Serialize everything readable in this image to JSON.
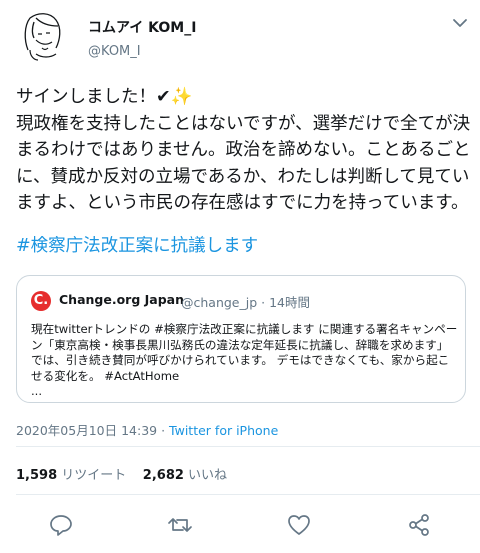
{
  "user": {
    "display_name": "コムアイ KOM_I",
    "handle": "@KOM_I"
  },
  "tweet": {
    "lines": [
      "サインしました！✔✨",
      "現政権を支持したことはないですが、選挙だけで全てが決",
      "まるわけではありません。政治を諦めない。ことあるごと",
      "に、賛成か反対の立場であるか、わたしは判断して見てい",
      "ますよ、という市民の存在感はすでに力を持っています。"
    ],
    "hashtag": "#検察庁法改正案に抗議します"
  },
  "quote": {
    "logo_letter": "C.",
    "name": "Change.org Japan",
    "handle_time": "@change_jp · 14時間",
    "lines": [
      "現在twitterトレンドの #検察庁法改正案に抗議します に関連する署名キャンペー",
      "ン「東京高検・検事長黒川弘務氏の違法な定年延長に抗議し、辞職を求めます」",
      "では、引き続き賛同が呼びかけられています。 デモはできなくても、家から起こ",
      "せる変化を。 #ActAtHome",
      "..."
    ]
  },
  "meta": {
    "datetime": "2020年05月10日 14:39 · ",
    "source": "Twitter for iPhone"
  },
  "stats": {
    "retweets_count": "1,598",
    "retweets_label": " リツイート",
    "likes_count": "2,682",
    "likes_label": " いいね"
  },
  "colors": {
    "link": "#1b95e0",
    "secondary": "#657786",
    "brand_change": "#e62d2d"
  },
  "icons": [
    "avatar-drawing",
    "chevron-down-icon",
    "change-org-logo",
    "reply-icon",
    "retweet-icon",
    "like-icon",
    "share-icon"
  ]
}
